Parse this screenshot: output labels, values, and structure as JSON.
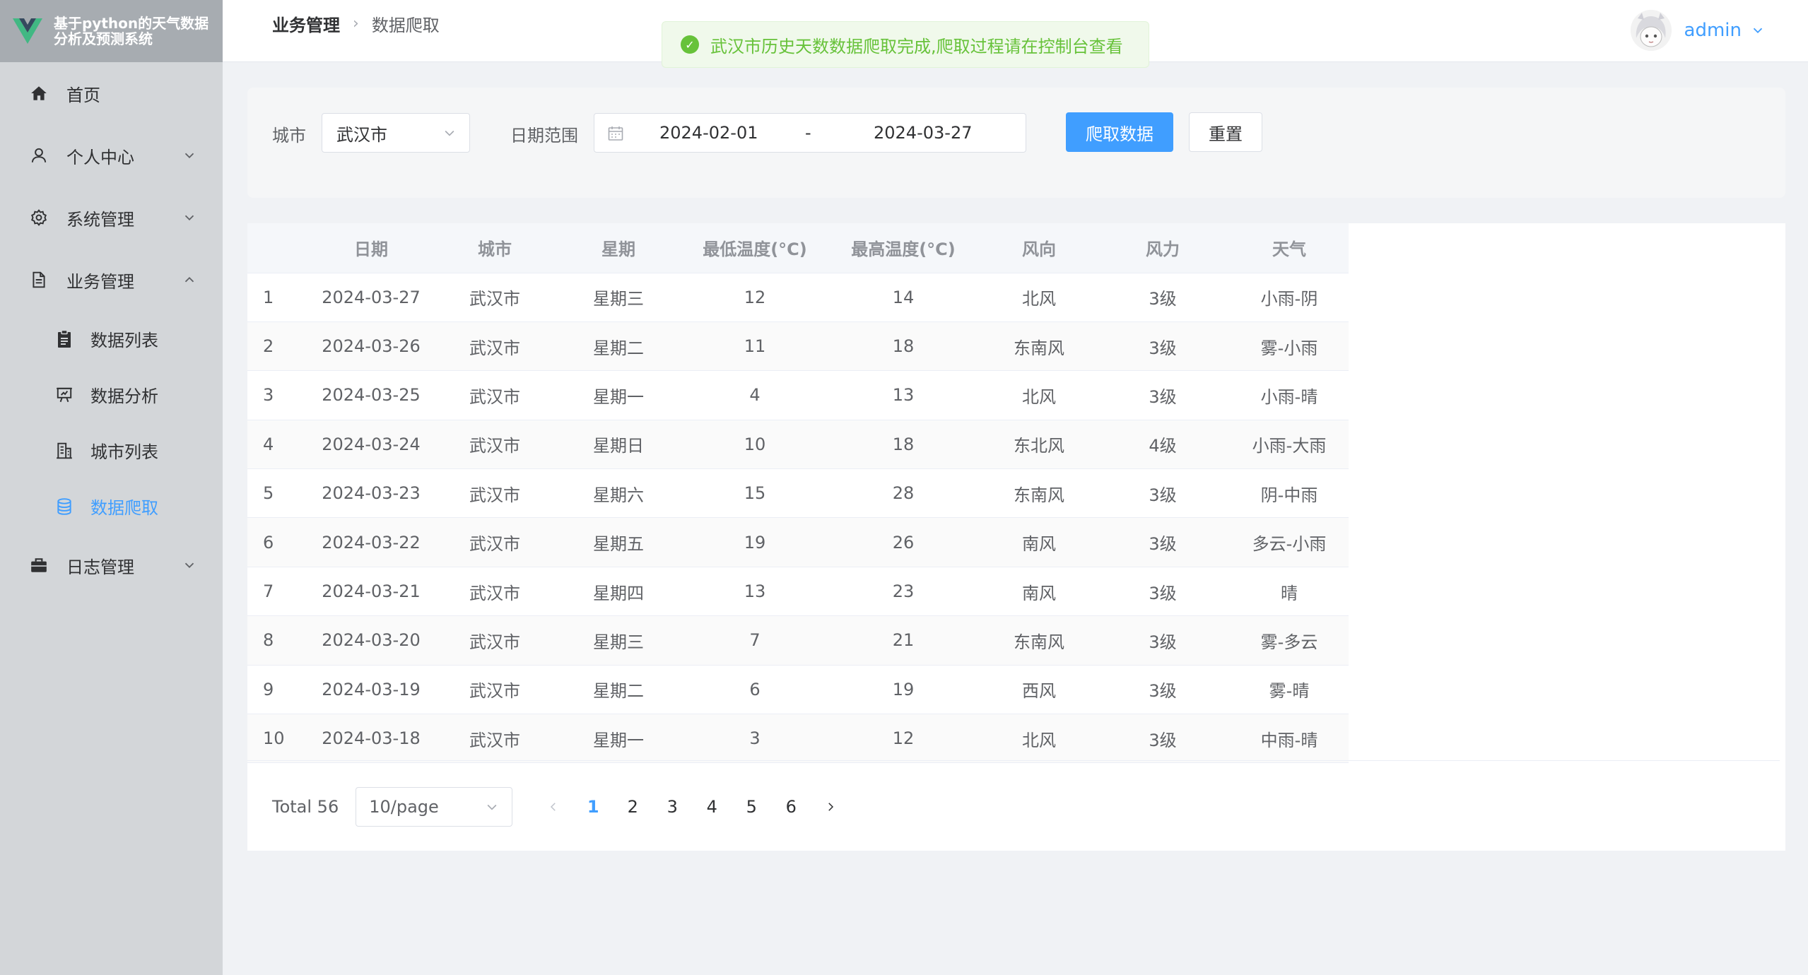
{
  "app": {
    "title": "基于python的天气数据分析及预测系统"
  },
  "sidebar": {
    "items": [
      {
        "label": "首页",
        "icon": "home-icon"
      },
      {
        "label": "个人中心",
        "icon": "user-icon",
        "expandable": true
      },
      {
        "label": "系统管理",
        "icon": "gear-icon",
        "expandable": true
      },
      {
        "label": "业务管理",
        "icon": "document-icon",
        "expanded": true
      },
      {
        "label": "日志管理",
        "icon": "briefcase-icon",
        "expandable": true
      }
    ],
    "subitems": [
      {
        "label": "数据列表",
        "icon": "clipboard-icon"
      },
      {
        "label": "数据分析",
        "icon": "presentation-icon"
      },
      {
        "label": "城市列表",
        "icon": "building-icon"
      },
      {
        "label": "数据爬取",
        "icon": "database-icon",
        "active": true
      }
    ]
  },
  "header": {
    "breadcrumb": [
      "业务管理",
      "数据爬取"
    ],
    "username": "admin"
  },
  "toast": {
    "message": "武汉市历史天数数据爬取完成,爬取过程请在控制台查看",
    "type": "success"
  },
  "search": {
    "city_label": "城市",
    "city_value": "武汉市",
    "date_label": "日期范围",
    "date_start": "2024-02-01",
    "date_sep": "-",
    "date_end": "2024-03-27",
    "crawl_button": "爬取数据",
    "reset_button": "重置"
  },
  "table": {
    "columns": [
      "",
      "日期",
      "城市",
      "星期",
      "最低温度(°C)",
      "最高温度(°C)",
      "风向",
      "风力",
      "天气"
    ],
    "rows": [
      [
        "1",
        "2024-03-27",
        "武汉市",
        "星期三",
        "12",
        "14",
        "北风",
        "3级",
        "小雨-阴"
      ],
      [
        "2",
        "2024-03-26",
        "武汉市",
        "星期二",
        "11",
        "18",
        "东南风",
        "3级",
        "雾-小雨"
      ],
      [
        "3",
        "2024-03-25",
        "武汉市",
        "星期一",
        "4",
        "13",
        "北风",
        "3级",
        "小雨-晴"
      ],
      [
        "4",
        "2024-03-24",
        "武汉市",
        "星期日",
        "10",
        "18",
        "东北风",
        "4级",
        "小雨-大雨"
      ],
      [
        "5",
        "2024-03-23",
        "武汉市",
        "星期六",
        "15",
        "28",
        "东南风",
        "3级",
        "阴-中雨"
      ],
      [
        "6",
        "2024-03-22",
        "武汉市",
        "星期五",
        "19",
        "26",
        "南风",
        "3级",
        "多云-小雨"
      ],
      [
        "7",
        "2024-03-21",
        "武汉市",
        "星期四",
        "13",
        "23",
        "南风",
        "3级",
        "晴"
      ],
      [
        "8",
        "2024-03-20",
        "武汉市",
        "星期三",
        "7",
        "21",
        "东南风",
        "3级",
        "雾-多云"
      ],
      [
        "9",
        "2024-03-19",
        "武汉市",
        "星期二",
        "6",
        "19",
        "西风",
        "3级",
        "雾-晴"
      ],
      [
        "10",
        "2024-03-18",
        "武汉市",
        "星期一",
        "3",
        "12",
        "北风",
        "3级",
        "中雨-晴"
      ]
    ]
  },
  "pagination": {
    "total": "Total 56",
    "page_size": "10/page",
    "pages": [
      "1",
      "2",
      "3",
      "4",
      "5",
      "6"
    ],
    "current": "1"
  },
  "colors": {
    "primary": "#409eff",
    "success": "#67c23a",
    "sidebar_bg": "#d3d6d9",
    "logo_bg": "#a7acb1"
  }
}
